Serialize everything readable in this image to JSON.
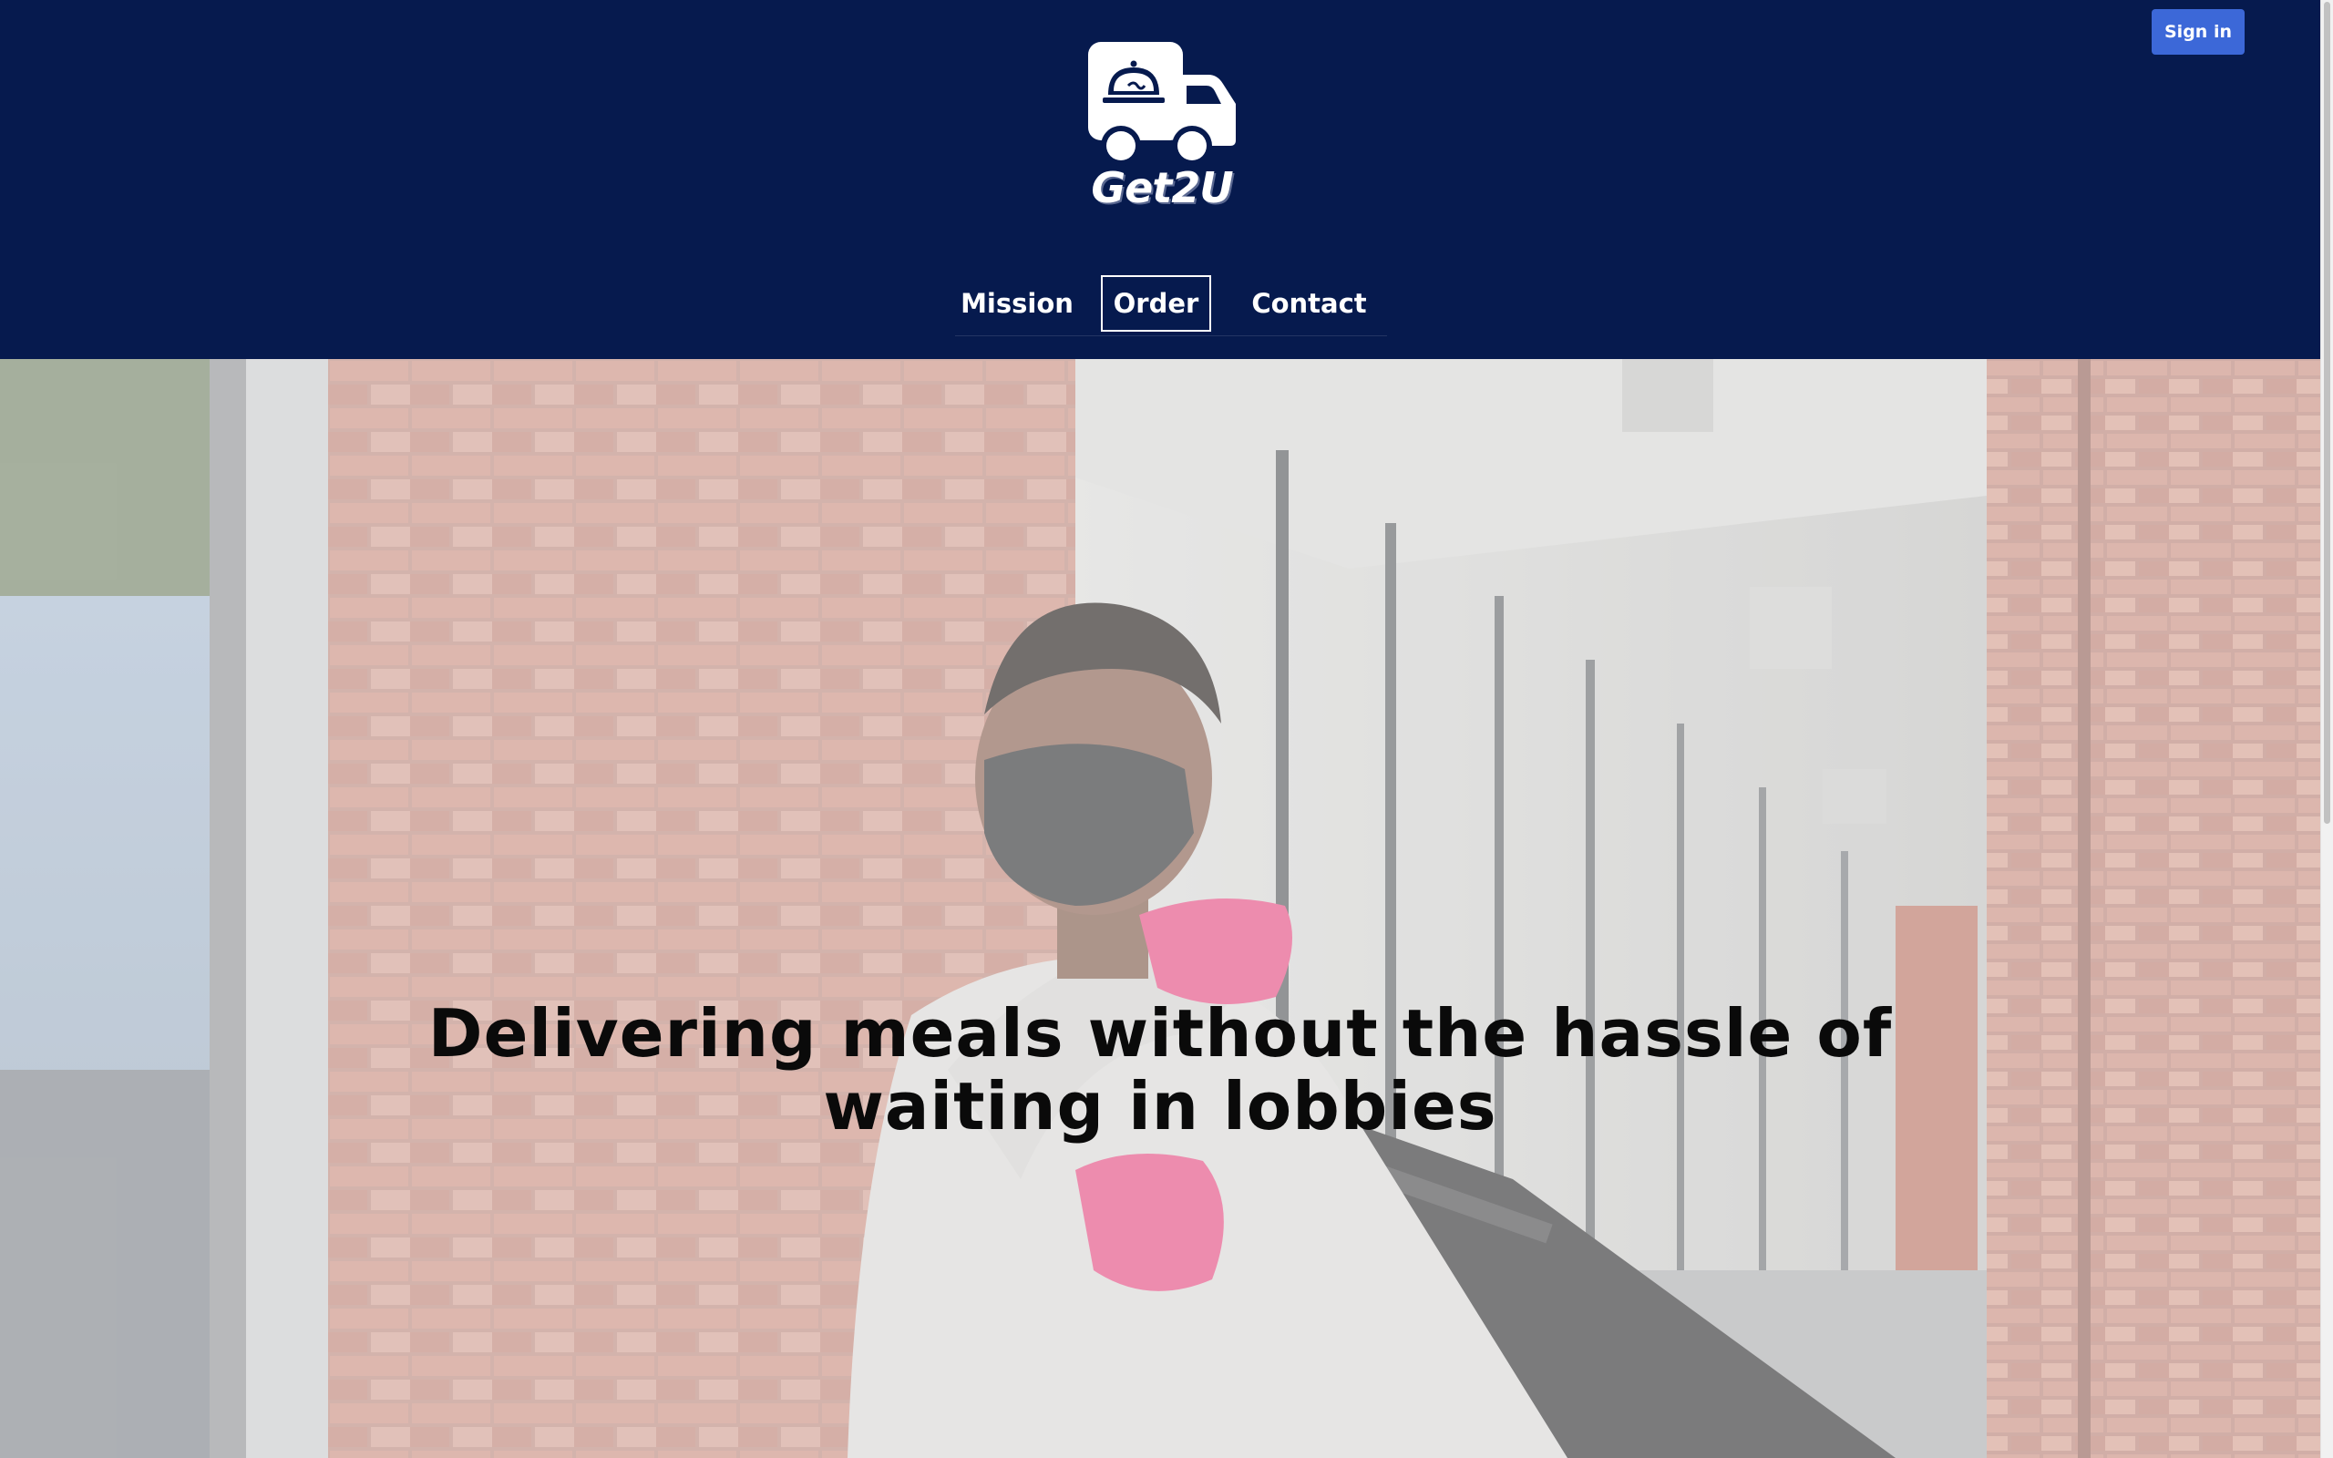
{
  "header": {
    "brand_name": "Get2U",
    "sign_in_label": "Sign in",
    "background_color": "#061a4e",
    "sign_in_color": "#3c68d8"
  },
  "nav": {
    "items": [
      {
        "label": "Mission",
        "active": false
      },
      {
        "label": "Order",
        "active": true
      },
      {
        "label": "Contact",
        "active": false
      }
    ]
  },
  "hero": {
    "headline": "Delivering meals without the hassle of waiting in lobbies",
    "image_description": "delivery-person-with-mask-and-thermal-bag",
    "overlay": "white-translucent"
  },
  "icons": {
    "logo": "delivery-truck-with-food-cloche-icon"
  }
}
